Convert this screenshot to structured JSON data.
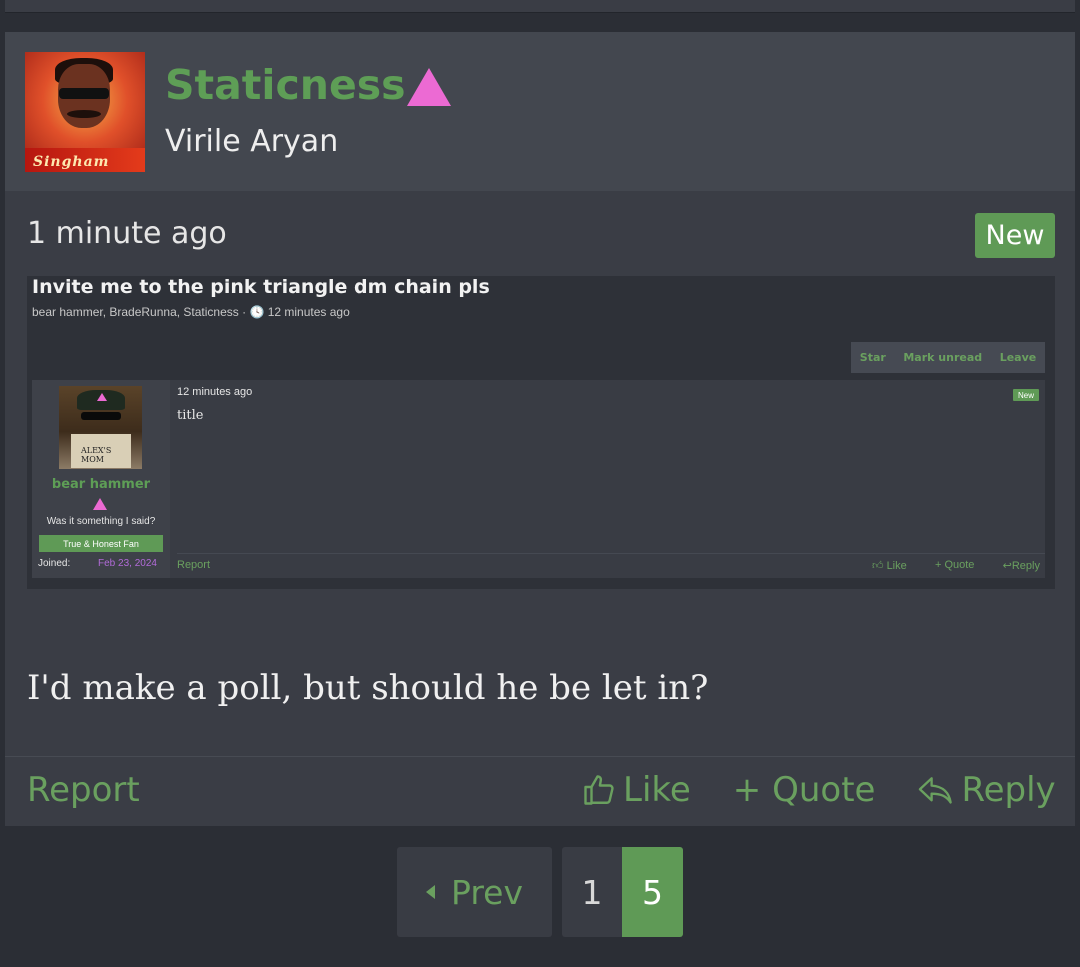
{
  "post": {
    "username": "Staticness",
    "user_title": "Virile Aryan",
    "time": "1 minute ago",
    "new_label": "New",
    "body": "I'd make a poll, but should he be let in?",
    "report_label": "Report",
    "actions": {
      "like": "Like",
      "quote": "+ Quote",
      "reply": "Reply"
    },
    "avatar_text": "Singham"
  },
  "embed": {
    "title": "Invite me to the pink triangle dm chain pls",
    "meta": "bear hammer, BradeRunna, Staticness · 🕓 12 minutes ago",
    "header_actions": {
      "star": "Star",
      "mark_unread": "Mark unread",
      "leave": "Leave"
    },
    "message": {
      "username": "bear hammer",
      "user_title": "Was it something I said?",
      "banner": "True & Honest Fan",
      "joined_label": "Joined:",
      "joined_value": "Feb 23, 2024",
      "time": "12 minutes ago",
      "new_label": "New",
      "body": "title",
      "report_label": "Report",
      "actions": {
        "like": "Like",
        "quote": "+ Quote",
        "reply": "Reply"
      },
      "avatar_text": "ALEX'S MOM"
    }
  },
  "pagination": {
    "prev_label": "Prev",
    "pages": [
      "1",
      "5"
    ],
    "current": "5"
  },
  "colors": {
    "background": "#2b2e35",
    "panel": "#3a3d45",
    "accent_green": "#5e9e56",
    "pink_triangle": "#ec6ad3"
  }
}
